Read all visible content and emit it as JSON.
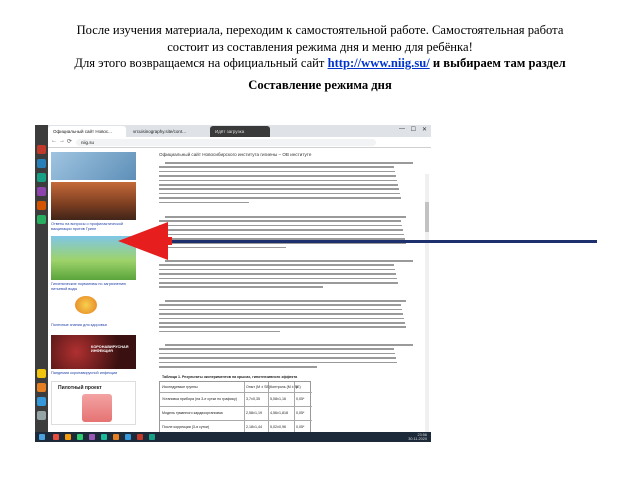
{
  "slide": {
    "line1": "После изучения материала, переходим к самостоятельной работе. Самостоятельная работа",
    "line2": "состоит из составления режима дня и меню для ребёнка!",
    "line3_before": "Для этого возвращаемся на официальный сайт",
    "url": "http://www.niig.su/",
    "line3_after": "и выбираем там раздел",
    "heading": "Составление режима дня"
  },
  "browser": {
    "tabs": [
      "Официальный сайт Новос...",
      "vrcuisinography.site/cont...",
      "Идёт загрузка",
      ""
    ],
    "window_controls": [
      "—",
      "☐",
      "✕"
    ],
    "address": "niig.su",
    "nav": [
      "←",
      "→",
      "⟳"
    ]
  },
  "page": {
    "header_title": "Официальный сайт Новосибирского института гигиены – ОВ институте",
    "left_links": [
      "Ответы на вопросы о профилактической вакцинации против Грипп",
      "Гигиенические нормативы по загрязнению питьевой воды",
      "Полезные знания для здоровья",
      "Пандемия коронавирусной инфекции"
    ],
    "healthy_banner": "Здоровый регион",
    "covid_banner": "КОРОНАВИРУСНАЯ ИНФЕКЦИЯ",
    "bottom_banner": "Пилотный проект",
    "table_title": "Таблица 1. Результаты экспериментов на крысах, гипотензивного эффекта",
    "table_headers": [
      "Исследуемые группы",
      "Опыт (M ± SE)",
      "Контроль (M ± SE)",
      "p"
    ],
    "table_rows": [
      [
        "Установка прибора (на 3-е сутки по графику)",
        "3,7±0,35",
        "5,08±1,16",
        "0,05*"
      ],
      [
        "Модель гуманного кардиоорганизма",
        "2,58±1,19",
        "4,56±1,818",
        "0,05*"
      ],
      [
        "После коррекции (3-я сутки)",
        "2,18±1,44",
        "5,02±0,96",
        "0,05*"
      ]
    ]
  },
  "taskbar": {
    "time": "23:56",
    "date": "30.11.2020"
  },
  "colors": {
    "link": "#0033cc",
    "arrow": "#e61e1e",
    "line": "#1e2f6e",
    "taskbar": "#1c2a3a"
  }
}
